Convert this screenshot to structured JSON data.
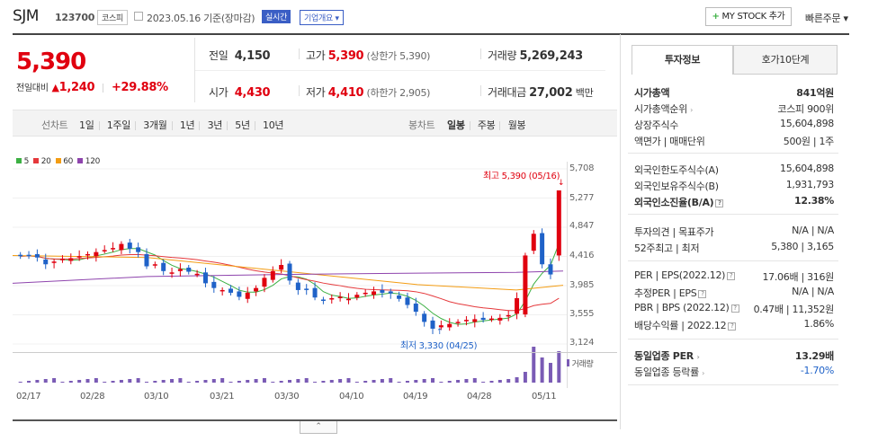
{
  "header": {
    "name": "SJM",
    "code": "123700",
    "market_badge": "코스피",
    "date_text": "2023.05.16 기준(장마감)",
    "realtime_badge": "실시간",
    "company_overview": "기업개요",
    "mystock_button": "MY STOCK 추가",
    "quick_order": "빠른주문"
  },
  "quote": {
    "price": "5,390",
    "change_label": "전일대비",
    "change": "1,240",
    "change_rate": "+29.88%",
    "prev_label": "전일",
    "prev": "4,150",
    "high_label": "고가",
    "high": "5,390",
    "upper_limit": "(상한가 5,390)",
    "volume_label": "거래량",
    "volume": "5,269,243",
    "open_label": "시가",
    "open": "4,430",
    "low_label": "저가",
    "low": "4,410",
    "lower_limit": "(하한가 2,905)",
    "amount_label": "거래대금",
    "amount": "27,002",
    "amount_unit": "백만"
  },
  "period_tabs": {
    "line_label": "선차트",
    "items": [
      "1일",
      "1주일",
      "3개월",
      "1년",
      "3년",
      "5년",
      "10년"
    ],
    "candle_label": "봉차트",
    "candle_items": [
      "일봉",
      "주봉",
      "월봉"
    ]
  },
  "legend": [
    {
      "label": "5",
      "color": "#3cb043"
    },
    {
      "label": "20",
      "color": "#e5383b"
    },
    {
      "label": "60",
      "color": "#f39c12"
    },
    {
      "label": "120",
      "color": "#8e44ad"
    }
  ],
  "chart_labels": {
    "high_note": "최고 5,390 (05/16)",
    "low_note": "최저 3,330 (04/25)",
    "volume_label": "거래량"
  },
  "chart_data": {
    "type": "candlestick",
    "y_ticks": [
      "5,708",
      "5,277",
      "4,847",
      "4,416",
      "3,985",
      "3,555",
      "3,124"
    ],
    "ylim": [
      3124,
      5708
    ],
    "x_ticks": [
      "02/17",
      "02/28",
      "03/10",
      "03/21",
      "03/30",
      "04/10",
      "04/19",
      "04/28",
      "05/11"
    ],
    "max_value": 5390,
    "max_date": "05/16",
    "min_value": 3330,
    "min_date": "04/25",
    "moving_averages": [
      "5",
      "20",
      "60",
      "120"
    ]
  },
  "right_panel": {
    "tabs": [
      "투자정보",
      "호가10단계"
    ],
    "rows": [
      {
        "label": "시가총액",
        "value": "841억원",
        "bold": true
      },
      {
        "label": "시가총액순위",
        "value": "코스피 900위"
      },
      {
        "label": "상장주식수",
        "value": "15,604,898"
      },
      {
        "label": "액면가 | 매매단위",
        "value": "500원 | 1주"
      },
      {
        "label": "외국인한도주식수(A)",
        "value": "15,604,898"
      },
      {
        "label": "외국인보유주식수(B)",
        "value": "1,931,793"
      },
      {
        "label": "외국인소진율(B/A)",
        "value": "12.38%",
        "bold": true
      },
      {
        "label": "투자의견 | 목표주가",
        "value": "N/A | N/A"
      },
      {
        "label": "52주최고 | 최저",
        "value": "5,380 | 3,165"
      },
      {
        "label": "PER | EPS(2022.12)",
        "value": "17.06배 | 316원"
      },
      {
        "label": "추정PER | EPS",
        "value": "N/A | N/A"
      },
      {
        "label": "PBR | BPS (2022.12)",
        "value": "0.47배 | 11,352원"
      },
      {
        "label": "배당수익률 | 2022.12",
        "value": "1.86%"
      },
      {
        "label": "동일업종 PER",
        "value": "13.29배",
        "bold": true
      },
      {
        "label": "동일업종 등락률",
        "value": "-1.70%"
      }
    ]
  },
  "colors": {
    "up": "#e0000f",
    "down": "#1f62c8",
    "accent": "#3a5ec5"
  }
}
